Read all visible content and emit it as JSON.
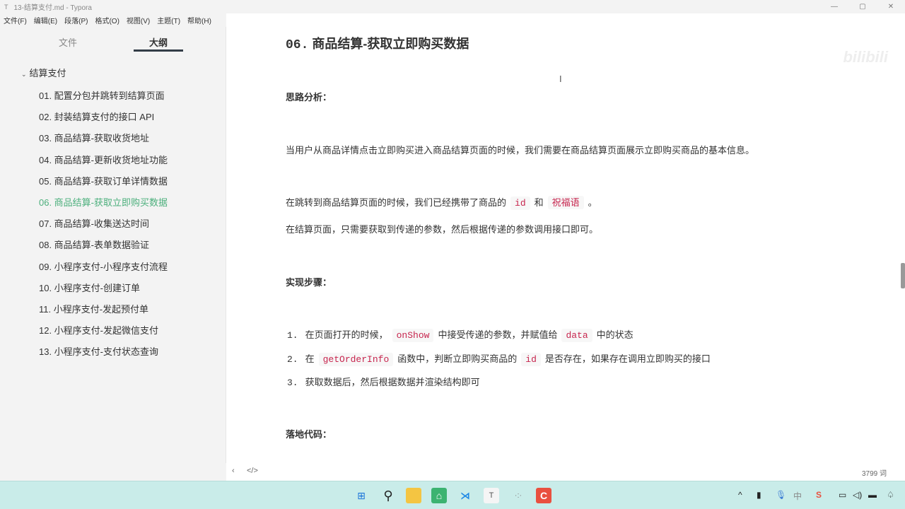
{
  "window": {
    "title": "13-结算支付.md - Typora",
    "app_icon": "T",
    "minimize": "—",
    "maximize": "▢",
    "close": "✕"
  },
  "menu": [
    "文件(F)",
    "编辑(E)",
    "段落(P)",
    "格式(O)",
    "视图(V)",
    "主题(T)",
    "帮助(H)"
  ],
  "sidebar": {
    "tabs": {
      "files": "文件",
      "outline": "大纲"
    },
    "root": "结算支付",
    "items": [
      "01. 配置分包并跳转到结算页面",
      "02. 封装结算支付的接口 API",
      "03. 商品结算-获取收货地址",
      "04. 商品结算-更新收货地址功能",
      "05. 商品结算-获取订单详情数据",
      "06. 商品结算-获取立即购买数据",
      "07. 商品结算-收集送达时间",
      "08. 商品结算-表单数据验证",
      "09. 小程序支付-小程序支付流程",
      "10. 小程序支付-创建订单",
      "11. 小程序支付-发起预付单",
      "12. 小程序支付-发起微信支付",
      "13. 小程序支付-支付状态查询"
    ],
    "active_index": 5
  },
  "doc": {
    "heading_num": "06.",
    "heading_text": "商品结算-获取立即购买数据",
    "h_analysis": "思路分析：",
    "p1": "当用户从商品详情点击立即购买进入商品结算页面的时候，我们需要在商品结算页面展示立即购买商品的基本信息。",
    "p2a": "在跳转到商品结算页面的时候，我们已经携带了商品的",
    "p2_code1": "id",
    "p2b": "和",
    "p2_code2": "祝福语",
    "p2c": "。",
    "p3": "在结算页面，只需要获取到传递的参数，然后根据传递的参数调用接口即可。",
    "h_steps": "实现步骤：",
    "steps": [
      {
        "n": "1.",
        "a": "在页面打开的时候，",
        "c1": "onShow",
        "b": "中接受传递的参数，并赋值给",
        "c2": "data",
        "c": "中的状态"
      },
      {
        "n": "2.",
        "a": "在",
        "c1": "getOrderInfo",
        "b": "函数中，判断立即购买商品的",
        "c2": "id",
        "c": "是否存在，如果存在调用立即购买的接口"
      },
      {
        "n": "3.",
        "a": "获取数据后，然后根据数据并渲染结构即可"
      }
    ],
    "h_code": "落地代码："
  },
  "status": {
    "toggle_sidebar": "‹",
    "source_mode": "</>",
    "word_count": "3799 词"
  },
  "watermark": "bilibili"
}
